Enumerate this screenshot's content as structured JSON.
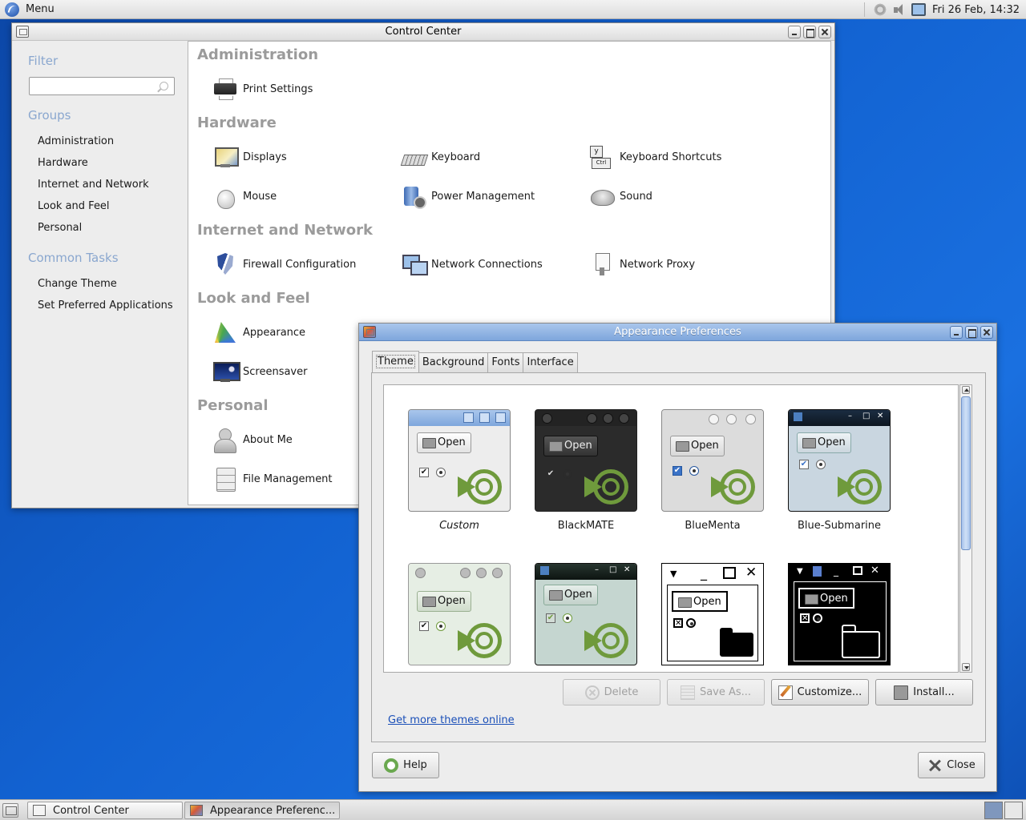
{
  "top_panel": {
    "menu_label": "Menu",
    "clock": "Fri 26 Feb, 14:32",
    "tray_icons": [
      "gear-icon",
      "volume-icon",
      "network-icon"
    ]
  },
  "control_center": {
    "title": "Control Center",
    "sidebar": {
      "filter_heading": "Filter",
      "filter_placeholder": "",
      "groups_heading": "Groups",
      "groups": [
        "Administration",
        "Hardware",
        "Internet and Network",
        "Look and Feel",
        "Personal"
      ],
      "tasks_heading": "Common Tasks",
      "tasks": [
        "Change Theme",
        "Set Preferred Applications"
      ]
    },
    "categories": [
      {
        "name": "Administration",
        "items": [
          {
            "label": "Print Settings",
            "icon": "printer-icon"
          }
        ]
      },
      {
        "name": "Hardware",
        "items": [
          {
            "label": "Displays",
            "icon": "display-icon"
          },
          {
            "label": "Keyboard",
            "icon": "keyboard-icon"
          },
          {
            "label": "Keyboard Shortcuts",
            "icon": "keyboard-shortcuts-icon"
          },
          {
            "label": "Mouse",
            "icon": "mouse-icon"
          },
          {
            "label": "Power Management",
            "icon": "power-management-icon"
          },
          {
            "label": "Sound",
            "icon": "sound-icon"
          }
        ]
      },
      {
        "name": "Internet and Network",
        "items": [
          {
            "label": "Firewall Configuration",
            "icon": "firewall-icon"
          },
          {
            "label": "Network Connections",
            "icon": "network-connections-icon"
          },
          {
            "label": "Network Proxy",
            "icon": "network-proxy-icon"
          }
        ]
      },
      {
        "name": "Look and Feel",
        "items": [
          {
            "label": "Appearance",
            "icon": "appearance-icon"
          },
          {
            "label": "Screensaver",
            "icon": "screensaver-icon"
          }
        ]
      },
      {
        "name": "Personal",
        "items": [
          {
            "label": "About Me",
            "icon": "about-me-icon"
          },
          {
            "label": "File Management",
            "icon": "file-management-icon"
          }
        ]
      }
    ]
  },
  "appearance": {
    "title": "Appearance Preferences",
    "tabs": [
      "Theme",
      "Background",
      "Fonts",
      "Interface"
    ],
    "active_tab": "Theme",
    "open_label": "Open",
    "themes": [
      {
        "name": "Custom",
        "style": "custom"
      },
      {
        "name": "BlackMATE",
        "style": "blackmate"
      },
      {
        "name": "BlueMenta",
        "style": "bluementa"
      },
      {
        "name": "Blue-Submarine",
        "style": "bluesub"
      },
      {
        "name": "",
        "style": "menta-green"
      },
      {
        "name": "",
        "style": "teal-dark"
      },
      {
        "name": "",
        "style": "hc-white"
      },
      {
        "name": "",
        "style": "hc-black"
      }
    ],
    "buttons": {
      "delete": "Delete",
      "save_as": "Save As...",
      "customize": "Customize...",
      "install": "Install..."
    },
    "link": "Get more themes online",
    "help": "Help",
    "close": "Close"
  },
  "taskbar": {
    "tasks": [
      "Control Center",
      "Appearance Preferenc..."
    ]
  },
  "colors": {
    "desktop": "#1262d1",
    "accent_title": "#7ea6dc",
    "category_heading": "#9b9b9b",
    "sidebar_heading": "#8aa7cf",
    "mate_green": "#6f9a3c",
    "link": "#1a4fb8"
  }
}
